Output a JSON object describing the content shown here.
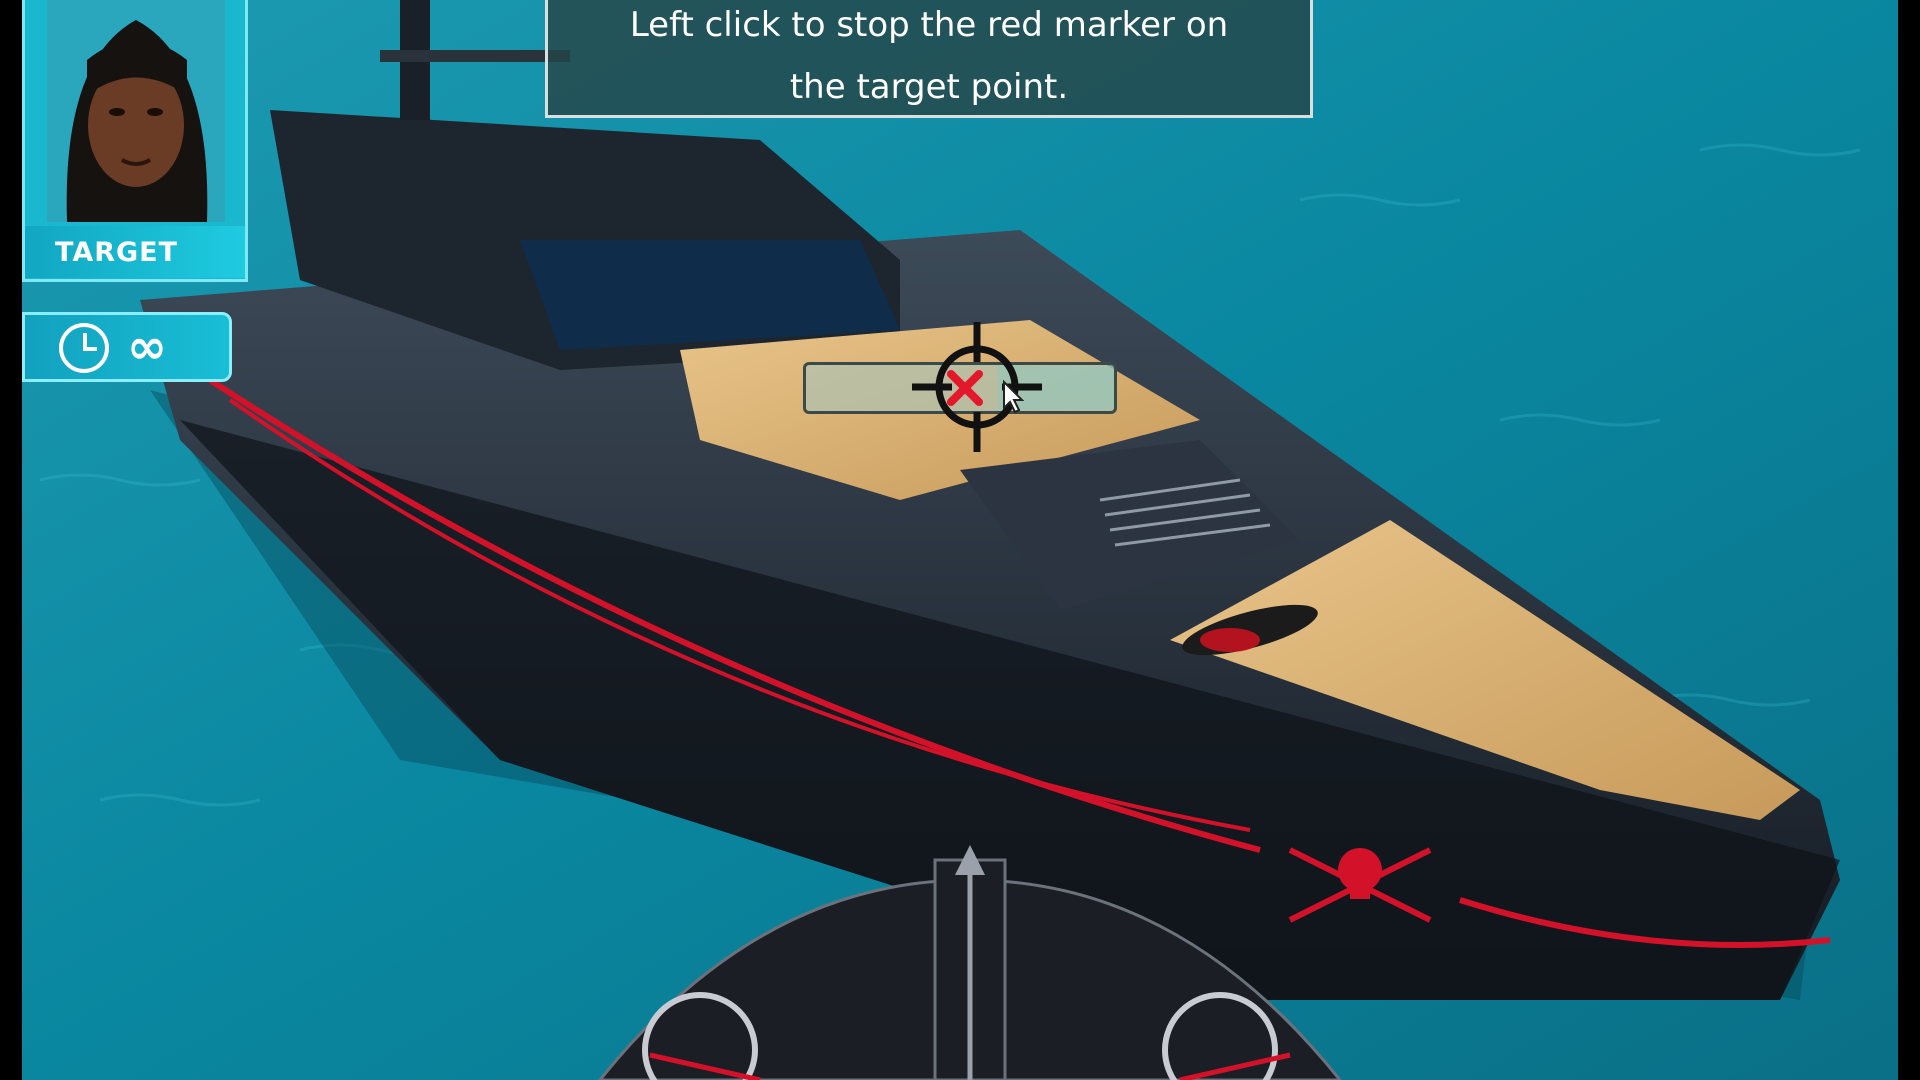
{
  "hud": {
    "target_label": "TARGET",
    "timer_value": "∞",
    "timer_icon": "clock-icon"
  },
  "instruction": {
    "line1": "Left click to stop the red marker on",
    "line2": "the target point."
  },
  "aim": {
    "marker_icon": "red-x-marker-icon",
    "crosshair_icon": "crosshair-icon"
  },
  "colors": {
    "hud_cyan": "#19b8cf",
    "marker_red": "#e3182b",
    "sea": "#0b7c96"
  }
}
